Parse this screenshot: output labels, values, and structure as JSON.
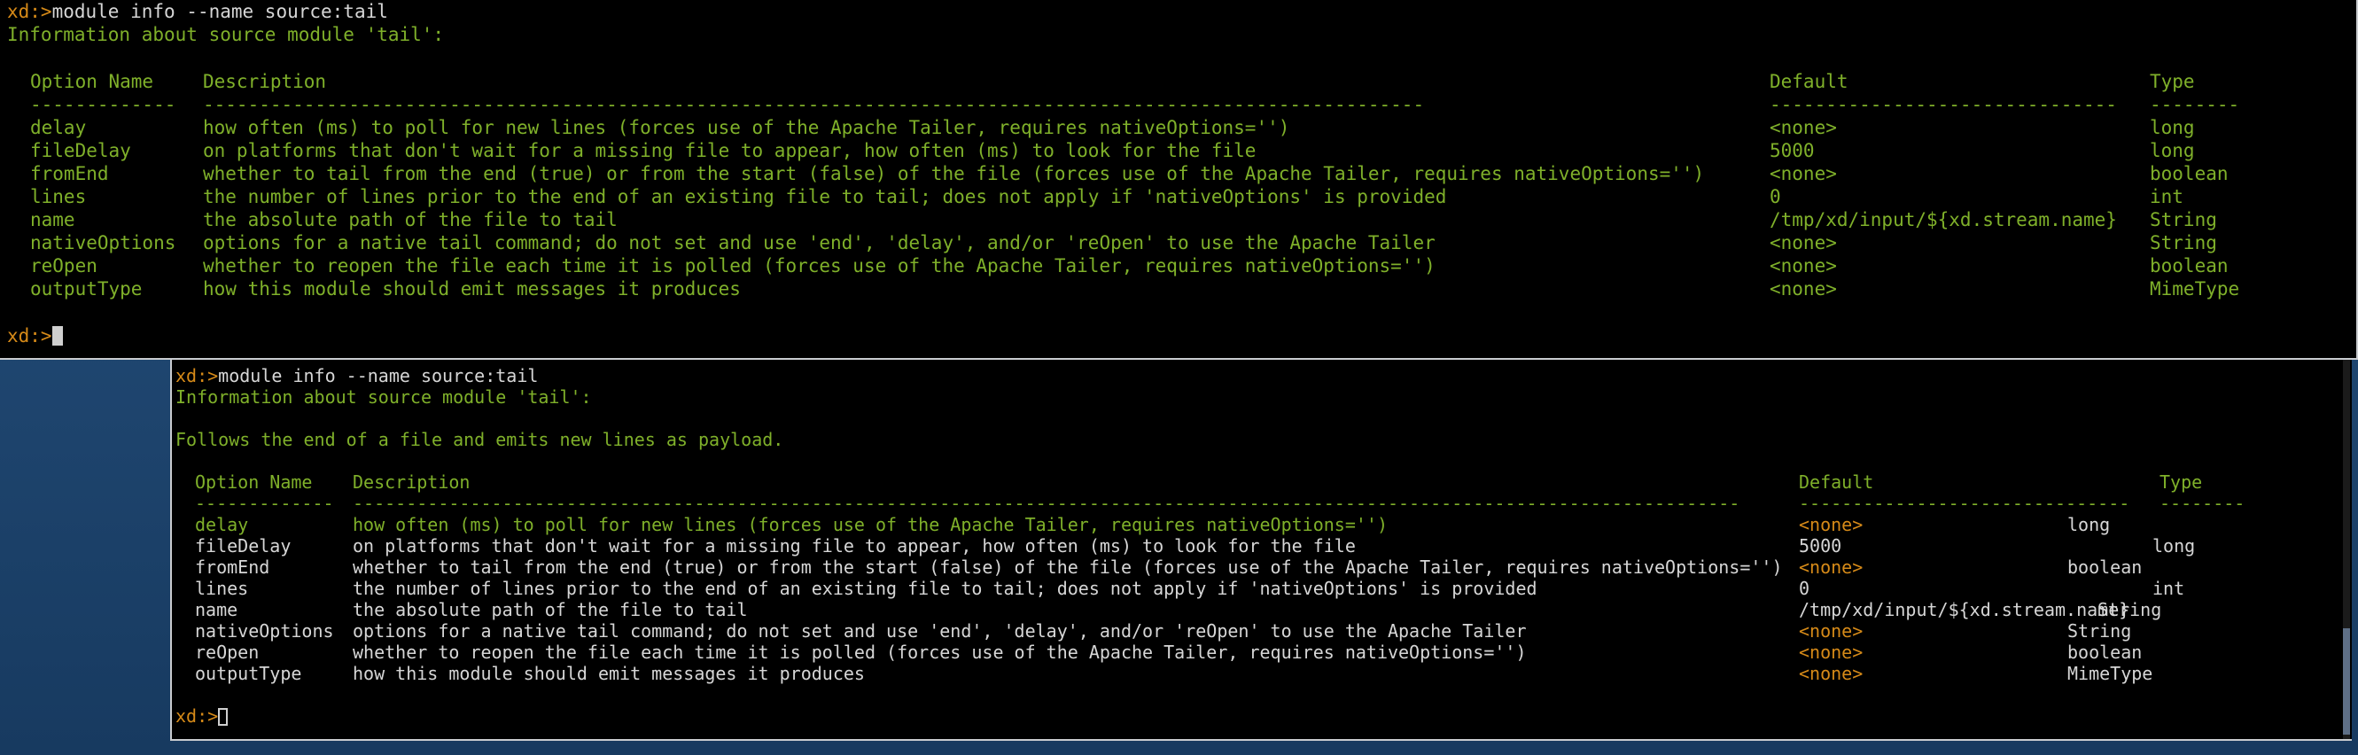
{
  "front": {
    "prompt": "xd:>",
    "command": "module info --name source:tail",
    "info_line": "Information about source module 'tail':",
    "headers": {
      "name": "Option Name",
      "desc": "Description",
      "def": "Default",
      "type": "Type"
    },
    "dashes": {
      "name": "-------------",
      "desc": "-------------------------------------------------------------------------------------------------------------",
      "def": "-------------------------------",
      "type": "--------"
    },
    "rows": [
      {
        "name": "delay",
        "desc": "how often (ms) to poll for new lines (forces use of the Apache Tailer, requires nativeOptions='')",
        "def": "<none>",
        "type": "long"
      },
      {
        "name": "fileDelay",
        "desc": "on platforms that don't wait for a missing file to appear, how often (ms) to look for the file",
        "def": "5000",
        "type": "long"
      },
      {
        "name": "fromEnd",
        "desc": "whether to tail from the end (true) or from the start (false) of the file (forces use of the Apache Tailer, requires nativeOptions='')",
        "def": "<none>",
        "type": "boolean"
      },
      {
        "name": "lines",
        "desc": "the number of lines prior to the end of an existing file to tail; does not apply if 'nativeOptions' is provided",
        "def": "0",
        "type": "int"
      },
      {
        "name": "name",
        "desc": "the absolute path of the file to tail",
        "def": "/tmp/xd/input/${xd.stream.name}",
        "type": "String"
      },
      {
        "name": "nativeOptions",
        "desc": "options for a native tail command; do not set and use 'end', 'delay', and/or 'reOpen' to use the Apache Tailer",
        "def": "<none>",
        "type": "String"
      },
      {
        "name": "reOpen",
        "desc": "whether to reopen the file each time it is polled (forces use of the Apache Tailer, requires nativeOptions='')",
        "def": "<none>",
        "type": "boolean"
      },
      {
        "name": "outputType",
        "desc": "how this module should emit messages it produces",
        "def": "<none>",
        "type": "MimeType"
      }
    ],
    "end_prompt": "xd:>"
  },
  "back": {
    "prompt": "xd:>",
    "command": "module info --name source:tail",
    "info_line": "Information about source module 'tail':",
    "summary": "Follows the end of a file and emits new lines as payload.",
    "headers": {
      "name": "Option Name",
      "desc": "Description",
      "def": "Default",
      "type": "Type"
    },
    "dashes": {
      "name": "-------------",
      "desc": "----------------------------------------------------------------------------------------------------------------------------------",
      "def": "-------------------------------",
      "type": "--------"
    },
    "rows": [
      {
        "name": "delay",
        "desc": "how often (ms) to poll for new lines (forces use of the Apache Tailer, requires nativeOptions='')",
        "def": "<none>",
        "type": "long"
      },
      {
        "name": "fileDelay",
        "desc": "on platforms that don't wait for a missing file to appear, how often (ms) to look for the file",
        "def": "5000",
        "type": "long"
      },
      {
        "name": "fromEnd",
        "desc": "whether to tail from the end (true) or from the start (false) of the file (forces use of the Apache Tailer, requires nativeOptions='')",
        "def": "<none>",
        "type": "boolean"
      },
      {
        "name": "lines",
        "desc": "the number of lines prior to the end of an existing file to tail; does not apply if 'nativeOptions' is provided",
        "def": "0",
        "type": "int"
      },
      {
        "name": "name",
        "desc": "the absolute path of the file to tail",
        "def": "/tmp/xd/input/${xd.stream.name}",
        "type": "String"
      },
      {
        "name": "nativeOptions",
        "desc": "options for a native tail command; do not set and use 'end', 'delay', and/or 'reOpen' to use the Apache Tailer",
        "def": "<none>",
        "type": "String"
      },
      {
        "name": "reOpen",
        "desc": "whether to reopen the file each time it is polled (forces use of the Apache Tailer, requires nativeOptions='')",
        "def": "<none>",
        "type": "boolean"
      },
      {
        "name": "outputType",
        "desc": "how this module should emit messages it produces",
        "def": "<none>",
        "type": "MimeType"
      }
    ],
    "end_prompt": "xd:>"
  }
}
